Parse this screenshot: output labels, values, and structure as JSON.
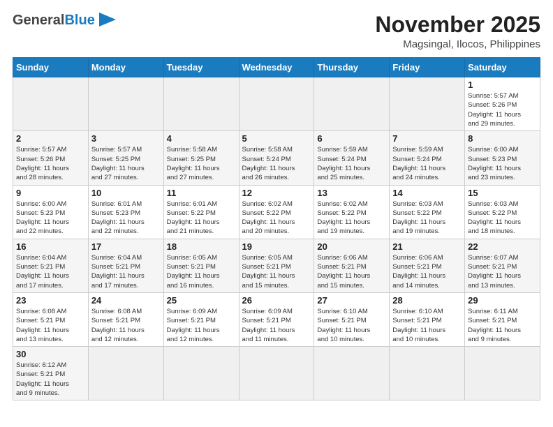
{
  "header": {
    "logo_general": "General",
    "logo_blue": "Blue",
    "month_title": "November 2025",
    "location": "Magsingal, Ilocos, Philippines"
  },
  "weekdays": [
    "Sunday",
    "Monday",
    "Tuesday",
    "Wednesday",
    "Thursday",
    "Friday",
    "Saturday"
  ],
  "weeks": [
    [
      {
        "day": "",
        "info": ""
      },
      {
        "day": "",
        "info": ""
      },
      {
        "day": "",
        "info": ""
      },
      {
        "day": "",
        "info": ""
      },
      {
        "day": "",
        "info": ""
      },
      {
        "day": "",
        "info": ""
      },
      {
        "day": "1",
        "info": "Sunrise: 5:57 AM\nSunset: 5:26 PM\nDaylight: 11 hours\nand 29 minutes."
      }
    ],
    [
      {
        "day": "2",
        "info": "Sunrise: 5:57 AM\nSunset: 5:26 PM\nDaylight: 11 hours\nand 28 minutes."
      },
      {
        "day": "3",
        "info": "Sunrise: 5:57 AM\nSunset: 5:25 PM\nDaylight: 11 hours\nand 27 minutes."
      },
      {
        "day": "4",
        "info": "Sunrise: 5:58 AM\nSunset: 5:25 PM\nDaylight: 11 hours\nand 27 minutes."
      },
      {
        "day": "5",
        "info": "Sunrise: 5:58 AM\nSunset: 5:24 PM\nDaylight: 11 hours\nand 26 minutes."
      },
      {
        "day": "6",
        "info": "Sunrise: 5:59 AM\nSunset: 5:24 PM\nDaylight: 11 hours\nand 25 minutes."
      },
      {
        "day": "7",
        "info": "Sunrise: 5:59 AM\nSunset: 5:24 PM\nDaylight: 11 hours\nand 24 minutes."
      },
      {
        "day": "8",
        "info": "Sunrise: 6:00 AM\nSunset: 5:23 PM\nDaylight: 11 hours\nand 23 minutes."
      }
    ],
    [
      {
        "day": "9",
        "info": "Sunrise: 6:00 AM\nSunset: 5:23 PM\nDaylight: 11 hours\nand 22 minutes."
      },
      {
        "day": "10",
        "info": "Sunrise: 6:01 AM\nSunset: 5:23 PM\nDaylight: 11 hours\nand 22 minutes."
      },
      {
        "day": "11",
        "info": "Sunrise: 6:01 AM\nSunset: 5:22 PM\nDaylight: 11 hours\nand 21 minutes."
      },
      {
        "day": "12",
        "info": "Sunrise: 6:02 AM\nSunset: 5:22 PM\nDaylight: 11 hours\nand 20 minutes."
      },
      {
        "day": "13",
        "info": "Sunrise: 6:02 AM\nSunset: 5:22 PM\nDaylight: 11 hours\nand 19 minutes."
      },
      {
        "day": "14",
        "info": "Sunrise: 6:03 AM\nSunset: 5:22 PM\nDaylight: 11 hours\nand 19 minutes."
      },
      {
        "day": "15",
        "info": "Sunrise: 6:03 AM\nSunset: 5:22 PM\nDaylight: 11 hours\nand 18 minutes."
      }
    ],
    [
      {
        "day": "16",
        "info": "Sunrise: 6:04 AM\nSunset: 5:21 PM\nDaylight: 11 hours\nand 17 minutes."
      },
      {
        "day": "17",
        "info": "Sunrise: 6:04 AM\nSunset: 5:21 PM\nDaylight: 11 hours\nand 17 minutes."
      },
      {
        "day": "18",
        "info": "Sunrise: 6:05 AM\nSunset: 5:21 PM\nDaylight: 11 hours\nand 16 minutes."
      },
      {
        "day": "19",
        "info": "Sunrise: 6:05 AM\nSunset: 5:21 PM\nDaylight: 11 hours\nand 15 minutes."
      },
      {
        "day": "20",
        "info": "Sunrise: 6:06 AM\nSunset: 5:21 PM\nDaylight: 11 hours\nand 15 minutes."
      },
      {
        "day": "21",
        "info": "Sunrise: 6:06 AM\nSunset: 5:21 PM\nDaylight: 11 hours\nand 14 minutes."
      },
      {
        "day": "22",
        "info": "Sunrise: 6:07 AM\nSunset: 5:21 PM\nDaylight: 11 hours\nand 13 minutes."
      }
    ],
    [
      {
        "day": "23",
        "info": "Sunrise: 6:08 AM\nSunset: 5:21 PM\nDaylight: 11 hours\nand 13 minutes."
      },
      {
        "day": "24",
        "info": "Sunrise: 6:08 AM\nSunset: 5:21 PM\nDaylight: 11 hours\nand 12 minutes."
      },
      {
        "day": "25",
        "info": "Sunrise: 6:09 AM\nSunset: 5:21 PM\nDaylight: 11 hours\nand 12 minutes."
      },
      {
        "day": "26",
        "info": "Sunrise: 6:09 AM\nSunset: 5:21 PM\nDaylight: 11 hours\nand 11 minutes."
      },
      {
        "day": "27",
        "info": "Sunrise: 6:10 AM\nSunset: 5:21 PM\nDaylight: 11 hours\nand 10 minutes."
      },
      {
        "day": "28",
        "info": "Sunrise: 6:10 AM\nSunset: 5:21 PM\nDaylight: 11 hours\nand 10 minutes."
      },
      {
        "day": "29",
        "info": "Sunrise: 6:11 AM\nSunset: 5:21 PM\nDaylight: 11 hours\nand 9 minutes."
      }
    ],
    [
      {
        "day": "30",
        "info": "Sunrise: 6:12 AM\nSunset: 5:21 PM\nDaylight: 11 hours\nand 9 minutes."
      },
      {
        "day": "",
        "info": ""
      },
      {
        "day": "",
        "info": ""
      },
      {
        "day": "",
        "info": ""
      },
      {
        "day": "",
        "info": ""
      },
      {
        "day": "",
        "info": ""
      },
      {
        "day": "",
        "info": ""
      }
    ]
  ]
}
